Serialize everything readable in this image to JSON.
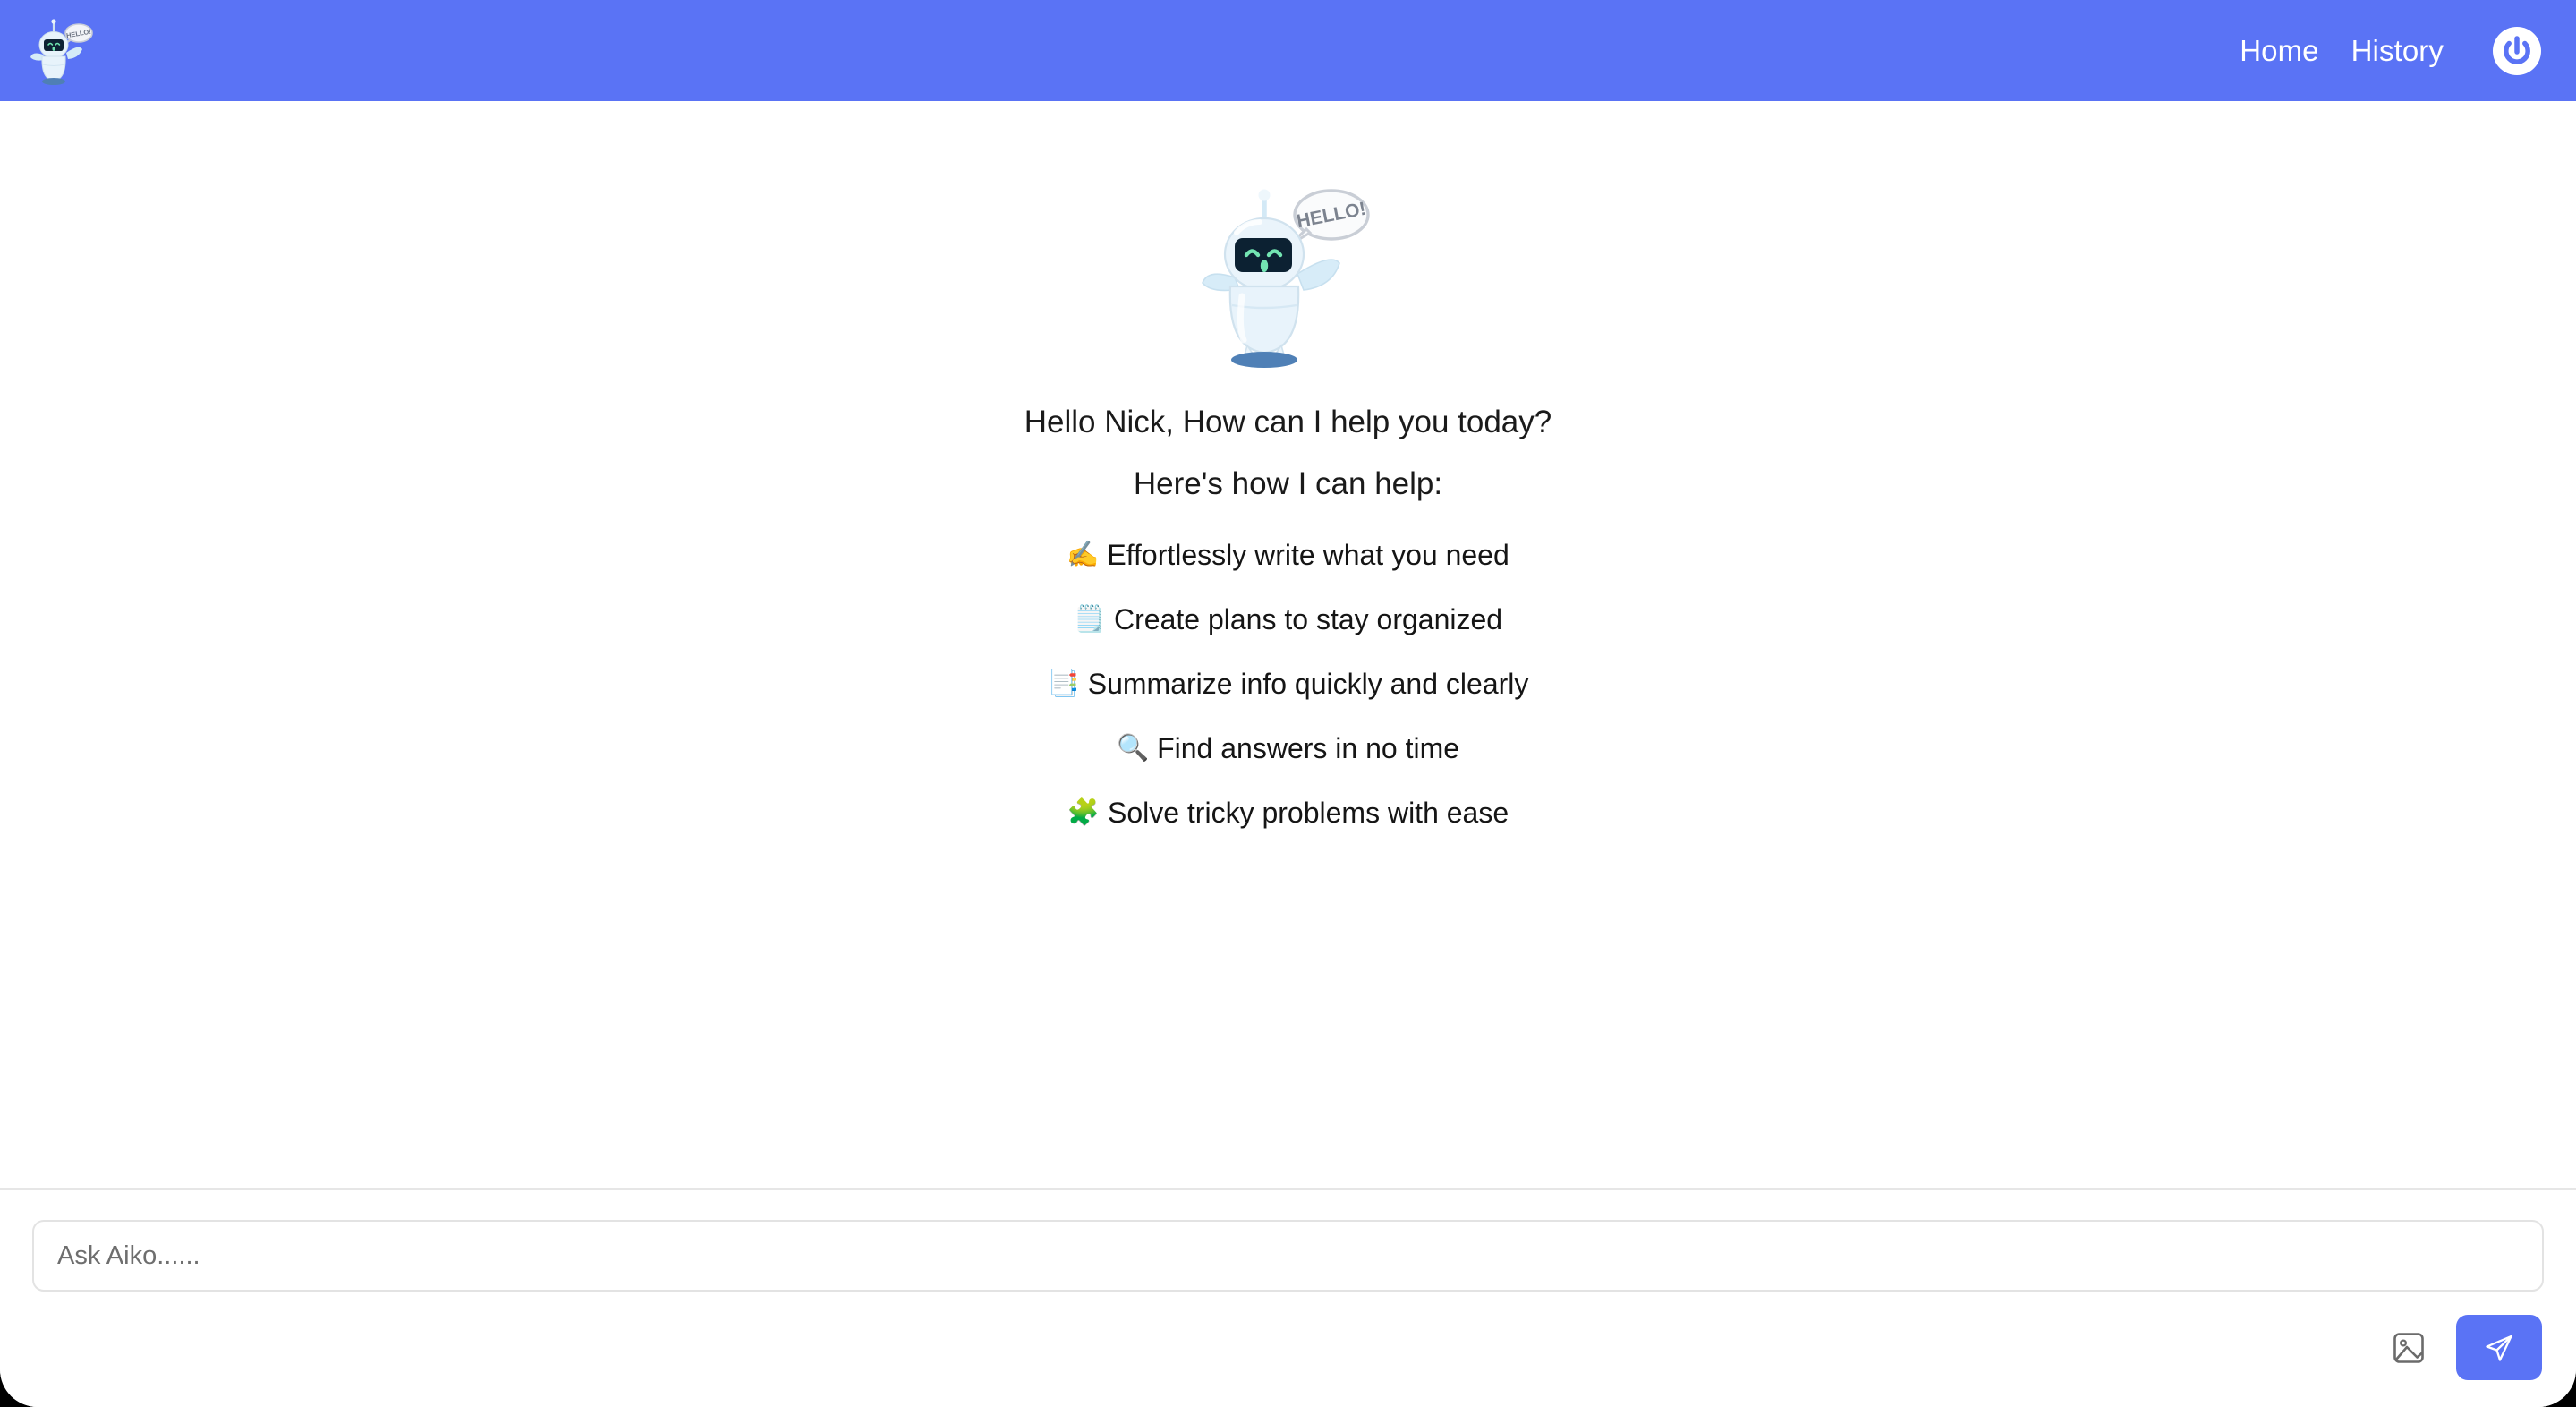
{
  "app": {
    "name": "Aiko",
    "accent_color": "#5a73f5",
    "page_background": "#ffffff",
    "window_background": "#000000"
  },
  "header": {
    "logo_icon": "robot-mascot-logo",
    "nav": [
      {
        "label": "Home",
        "icon": ""
      },
      {
        "label": "History",
        "icon": ""
      }
    ],
    "power_button": {
      "icon": "power-icon",
      "label": "Logout"
    }
  },
  "main": {
    "hero_icon": "robot-mascot-waving-hello",
    "hero_bubble_text": "HELLO!",
    "greeting": "Hello Nick, How can I help you today?",
    "subheading": "Here's how I can help:",
    "capabilities": [
      {
        "emoji": "✍️",
        "icon": "writing-hand-icon",
        "text": "Effortlessly write what you need"
      },
      {
        "emoji": "🗒️",
        "icon": "spiral-notepad-icon",
        "text": "Create plans to stay organized"
      },
      {
        "emoji": "📑",
        "icon": "bookmark-tabs-icon",
        "text": "Summarize info quickly and clearly"
      },
      {
        "emoji": "🔍",
        "icon": "magnifying-glass-icon",
        "text": "Find answers in no time"
      },
      {
        "emoji": "🧩",
        "icon": "puzzle-piece-icon",
        "text": "Solve tricky problems with ease"
      }
    ]
  },
  "composer": {
    "placeholder": "Ask Aiko......",
    "value": "",
    "attach_image": {
      "icon": "image-icon",
      "label": "Attach image"
    },
    "send": {
      "icon": "send-paper-plane-icon",
      "label": "Send"
    }
  }
}
